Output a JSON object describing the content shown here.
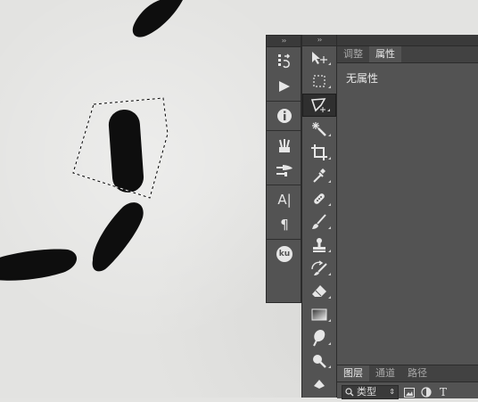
{
  "dock": {
    "collapse_glyph": "››",
    "icons": [
      {
        "name": "history-icon"
      },
      {
        "name": "actions-play-icon"
      },
      {
        "name": "info-icon"
      },
      {
        "name": "brush-presets-icon"
      },
      {
        "name": "brush-settings-icon"
      },
      {
        "name": "character-icon",
        "text": "A|"
      },
      {
        "name": "paragraph-icon",
        "text": "¶"
      },
      {
        "name": "kuler-icon",
        "text": "ku"
      }
    ]
  },
  "tools": {
    "collapse_glyph": "››",
    "items": [
      {
        "name": "move-tool-icon"
      },
      {
        "name": "marquee-tool-icon"
      },
      {
        "name": "polygonal-lasso-tool-icon",
        "active": true
      },
      {
        "name": "magic-wand-tool-icon"
      },
      {
        "name": "crop-tool-icon"
      },
      {
        "name": "eyedropper-tool-icon"
      },
      {
        "name": "healing-brush-tool-icon"
      },
      {
        "name": "brush-tool-icon"
      },
      {
        "name": "clone-stamp-tool-icon"
      },
      {
        "name": "history-brush-tool-icon"
      },
      {
        "name": "eraser-tool-icon"
      },
      {
        "name": "gradient-tool-icon"
      },
      {
        "name": "blur-tool-icon"
      },
      {
        "name": "dodge-tool-icon"
      },
      {
        "name": "pen-tool-icon"
      }
    ]
  },
  "properties": {
    "header_glyph": "",
    "tabs": [
      {
        "label": "调整",
        "active": false
      },
      {
        "label": "属性",
        "active": true
      }
    ],
    "empty_text": "无属性"
  },
  "layers": {
    "tabs": [
      {
        "label": "图层",
        "active": true
      },
      {
        "label": "通道",
        "active": false
      },
      {
        "label": "路径",
        "active": false
      }
    ],
    "filter_label": "类型",
    "filter_icons": [
      "image-filter-icon",
      "adjustment-filter-icon",
      "type-filter-icon"
    ],
    "type_filter_text": "T"
  },
  "colors": {
    "panel_bg": "#535353",
    "panel_dark": "#3a3a3a",
    "canvas_bg": "#e3e3e1",
    "ink": "#0d0d0d"
  }
}
